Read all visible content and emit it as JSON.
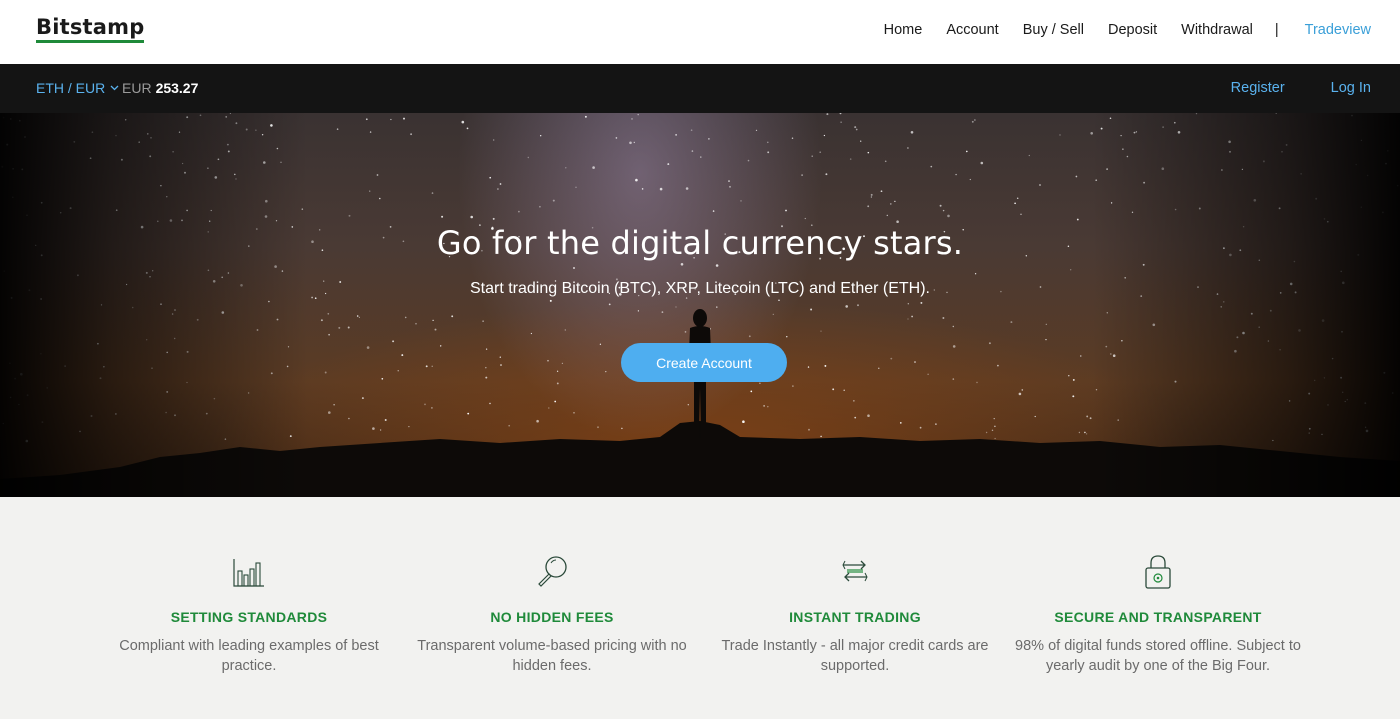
{
  "header": {
    "logo": "Bitstamp",
    "nav": [
      "Home",
      "Account",
      "Buy / Sell",
      "Deposit",
      "Withdrawal"
    ],
    "separator": "|",
    "tradeview": "Tradeview"
  },
  "ticker": {
    "pair": "ETH / EUR",
    "currency": "EUR",
    "price": "253.27",
    "register": "Register",
    "login": "Log In"
  },
  "hero": {
    "title": "Go for the digital currency stars.",
    "subtitle": "Start trading Bitcoin (BTC), XRP, Litecoin (LTC) and Ether (ETH).",
    "cta": "Create Account"
  },
  "features": [
    {
      "icon": "bar-chart-icon",
      "title": "SETTING STANDARDS",
      "line1": "Compliant with leading examples of best",
      "line2": "practice."
    },
    {
      "icon": "magnifier-icon",
      "title": "NO HIDDEN FEES",
      "line1": "Transparent volume-based pricing with no",
      "line2": "hidden fees."
    },
    {
      "icon": "exchange-arrows-icon",
      "title": "INSTANT TRADING",
      "line1": "Trade Instantly - all major credit cards are",
      "line2": "supported."
    },
    {
      "icon": "lock-icon",
      "title": "SECURE AND TRANSPARENT",
      "line1": "98% of digital funds stored offline. Subject to",
      "line2": "yearly audit by one of the Big Four."
    }
  ],
  "colors": {
    "accent_blue": "#4eaef0",
    "link_blue": "#5ab2ee",
    "brand_green": "#1f8a3a",
    "ticker_bg": "#141414"
  }
}
